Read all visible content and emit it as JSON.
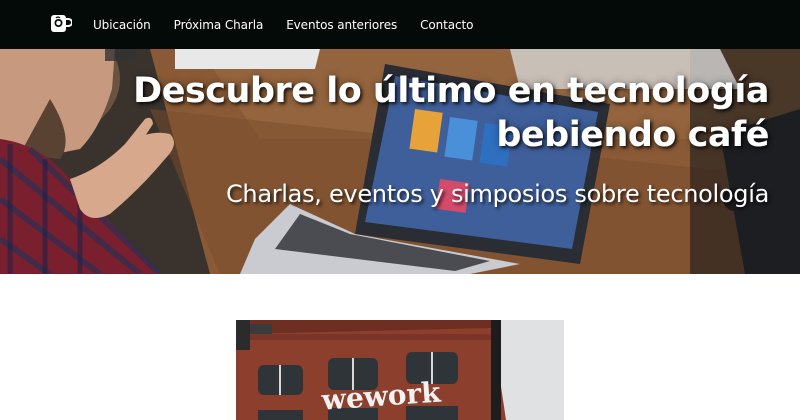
{
  "nav": {
    "logo_icon": "coffee-cup-icon",
    "links": [
      {
        "label": "Ubicación"
      },
      {
        "label": "Próxima Charla"
      },
      {
        "label": "Eventos anteriores"
      },
      {
        "label": "Contacto"
      }
    ]
  },
  "hero": {
    "title_line1": "Descubre lo último en tecnología",
    "title_line2": "bebiendo café",
    "subtitle": "Charlas, eventos y simposios sobre tecnología"
  },
  "event_photo": {
    "sign_text": "wework"
  },
  "colors": {
    "navbar_bg": "#040a07",
    "text": "#ffffff"
  }
}
